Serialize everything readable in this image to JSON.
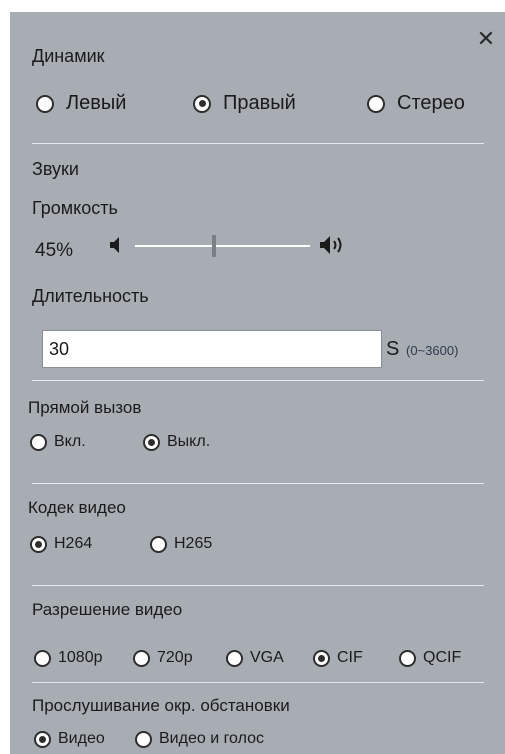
{
  "speaker": {
    "title": "Динамик",
    "options": [
      {
        "label": "Левый",
        "selected": false
      },
      {
        "label": "Правый",
        "selected": true
      },
      {
        "label": "Стерео",
        "selected": false
      }
    ]
  },
  "sounds": {
    "title": "Звуки",
    "volume_label": "Громкость",
    "volume_value": "45%",
    "volume_level": 0.45,
    "duration_label": "Длительность",
    "duration_value": "30",
    "duration_unit": "S",
    "duration_range": "(0~3600)"
  },
  "direct_call": {
    "title": "Прямой вызов",
    "options": [
      {
        "label": "Вкл.",
        "selected": false
      },
      {
        "label": "Выкл.",
        "selected": true
      }
    ]
  },
  "video_codec": {
    "title": "Кодек видео",
    "options": [
      {
        "label": "H264",
        "selected": true
      },
      {
        "label": "H265",
        "selected": false
      }
    ]
  },
  "video_resolution": {
    "title": "Разрешение видео",
    "options": [
      {
        "label": "1080p",
        "selected": false
      },
      {
        "label": "720p",
        "selected": false
      },
      {
        "label": "VGA",
        "selected": false
      },
      {
        "label": "CIF",
        "selected": true
      },
      {
        "label": "QCIF",
        "selected": false
      }
    ]
  },
  "ambient_listen": {
    "title": "Прослушивание окр. обстановки",
    "options": [
      {
        "label": "Видео",
        "selected": true
      },
      {
        "label": "Видео и голос",
        "selected": false
      }
    ]
  },
  "icons": {
    "close": "close-icon",
    "volume_low": "speaker-low-icon",
    "volume_high": "speaker-high-icon"
  }
}
